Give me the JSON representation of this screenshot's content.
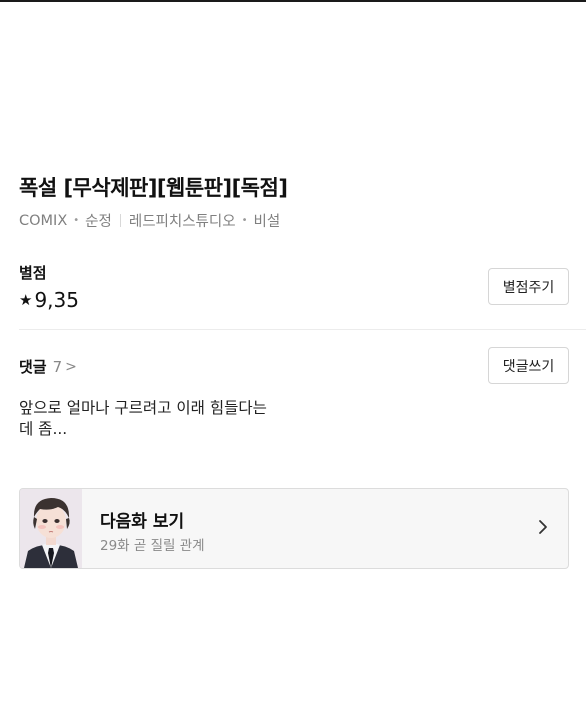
{
  "work": {
    "title": "폭설 [무삭제판][웹툰판][독점]",
    "publisher": "COMIX",
    "genre": "순정",
    "author": "레드피치스튜디오",
    "status": "비설"
  },
  "rating": {
    "label": "별점",
    "star_glyph": "★",
    "value": "9,35",
    "rate_button": "별점주기"
  },
  "comments": {
    "label": "댓글",
    "count": "7",
    "chevron": ">",
    "write_button": "댓글쓰기",
    "preview_text": "앞으로 얼마나 구르려고 이래 힘들다는데 좀..."
  },
  "next_episode": {
    "title": "다음화 보기",
    "subtitle": "29화 곧 질릴 관계",
    "icon": "chevron-right-icon"
  },
  "colors": {
    "text_primary": "#111111",
    "text_secondary": "#808080",
    "border": "#d6d6d6",
    "card_bg": "#f7f7f7"
  }
}
